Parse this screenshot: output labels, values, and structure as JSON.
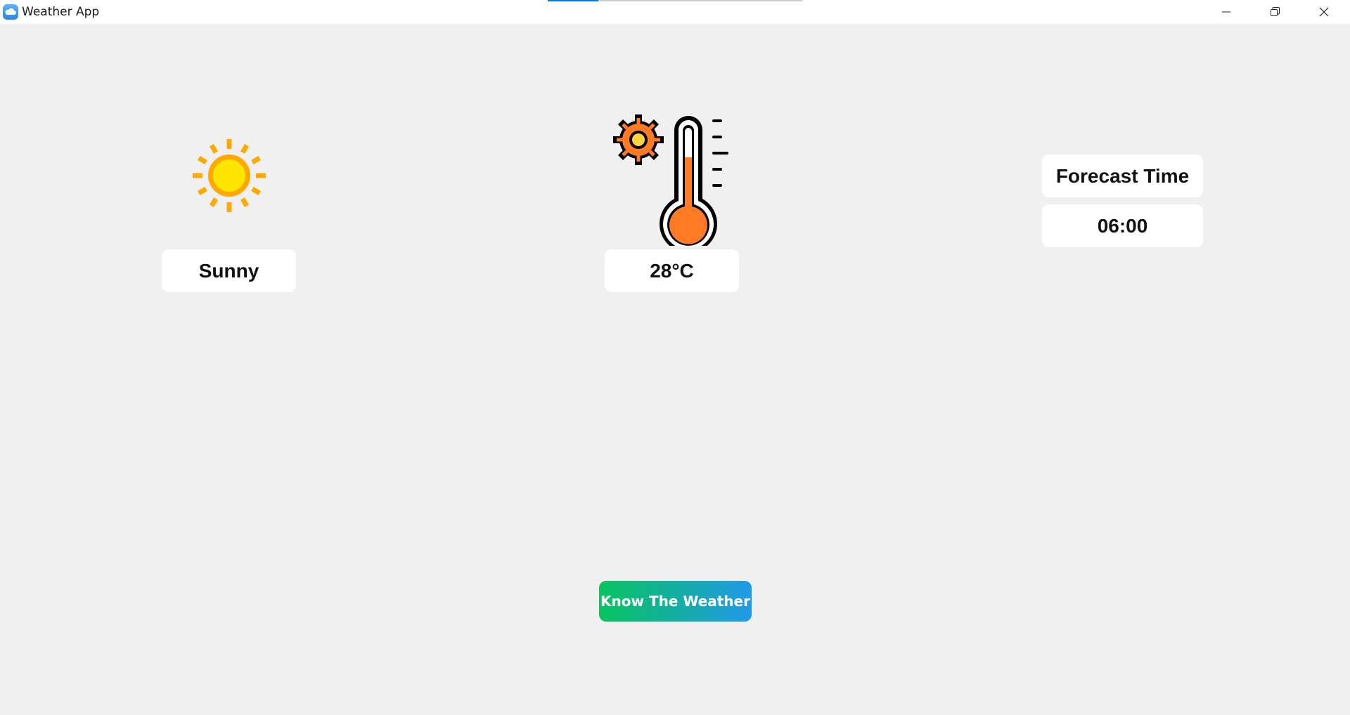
{
  "window": {
    "title": "Weather App",
    "loading_progress": 0.2,
    "controls": {
      "minimize_icon": "minimize-icon",
      "restore_icon": "restore-icon",
      "close_icon": "close-icon"
    }
  },
  "weather": {
    "condition_icon": "sun-icon",
    "condition": "Sunny",
    "temperature_icon": "thermometer-sun-icon",
    "temperature": "28°C"
  },
  "forecast": {
    "title": "Forecast Time",
    "time": "06:00"
  },
  "action": {
    "label": "Know The Weather"
  },
  "colors": {
    "background": "#f0f0f0",
    "card": "#ffffff",
    "sun_ray": "#ffa800",
    "sun_core": "#ffe600",
    "thermometer_fill": "#ff7a24",
    "button_gradient_start": "#08c35f",
    "button_gradient_end": "#2299e8",
    "progress_accent": "#0a78d7"
  }
}
